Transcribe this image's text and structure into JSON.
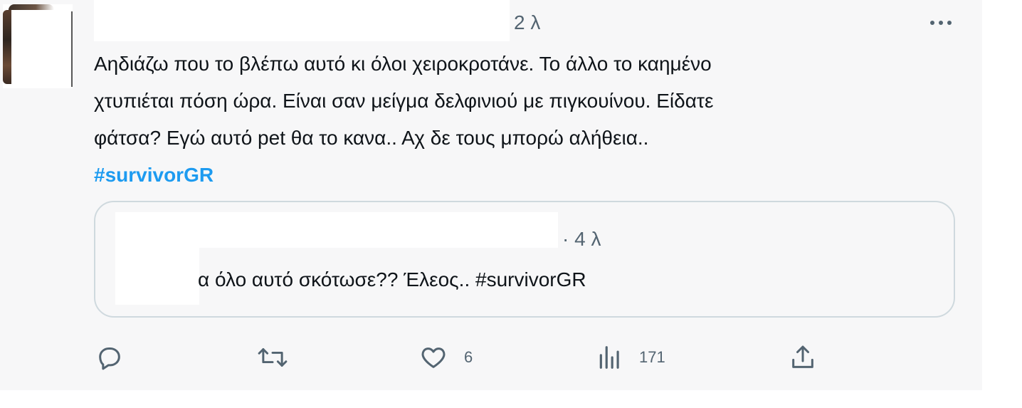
{
  "tweet": {
    "timestamp": "2 λ",
    "text_lines": [
      "Αηδιάζω που το βλέπω αυτό κι όλοι χειροκροτάνε. Το άλλο το καημένο",
      "χτυπιέται πόση ώρα. Είναι σαν μείγμα δελφινιού με πιγκουίνου. Είδατε",
      "φάτσα? Εγώ αυτό pet θα το κανα.. Αχ δε τους μπορώ αλήθεια.."
    ],
    "hashtag": "#survivorGR",
    "more_icon": "more-horizontal-icon"
  },
  "quoted": {
    "timestamp": "· 4 λ",
    "text": "α όλο αυτό σκότωσε?? Έλεος.. #survivorGR"
  },
  "actions": {
    "reply": {
      "icon": "reply-icon",
      "count": ""
    },
    "retweet": {
      "icon": "retweet-icon",
      "count": ""
    },
    "like": {
      "icon": "heart-icon",
      "count": "6"
    },
    "views": {
      "icon": "views-icon",
      "count": "171"
    },
    "share": {
      "icon": "share-icon",
      "count": ""
    }
  },
  "colors": {
    "hashtag": "#1d9bf0",
    "secondary_text": "#536471",
    "primary_text": "#0f1419",
    "border": "#cfd9de"
  }
}
